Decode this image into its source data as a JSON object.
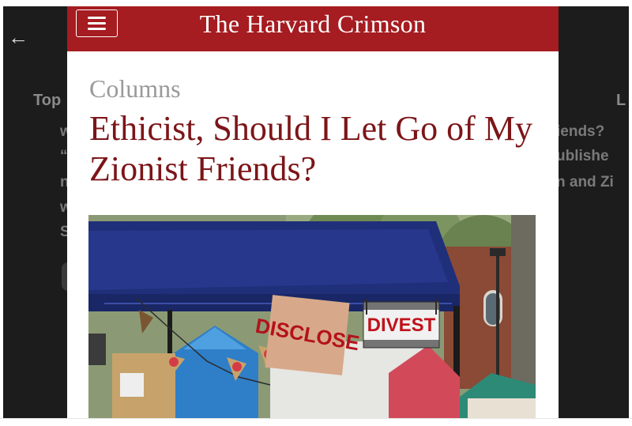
{
  "background": {
    "back_glyph": "←",
    "tab_left": "Top",
    "tab_right": "L",
    "left_lines": [
      "w",
      "“",
      "n",
      "w",
      "S"
    ],
    "right_lines": [
      "iends?",
      "ublishe",
      "n and Zi"
    ]
  },
  "masthead": {
    "menu_icon": "hamburger-menu-icon",
    "title": "The Harvard Crimson",
    "color": "#a51c21"
  },
  "article": {
    "section": "Columns",
    "headline": "Ethicist, Should I Let Go of My Zionist Friends?",
    "headline_color": "#7c1518"
  },
  "photo": {
    "sign_left": "DISCLOSE",
    "sign_right": "DIVEST"
  }
}
